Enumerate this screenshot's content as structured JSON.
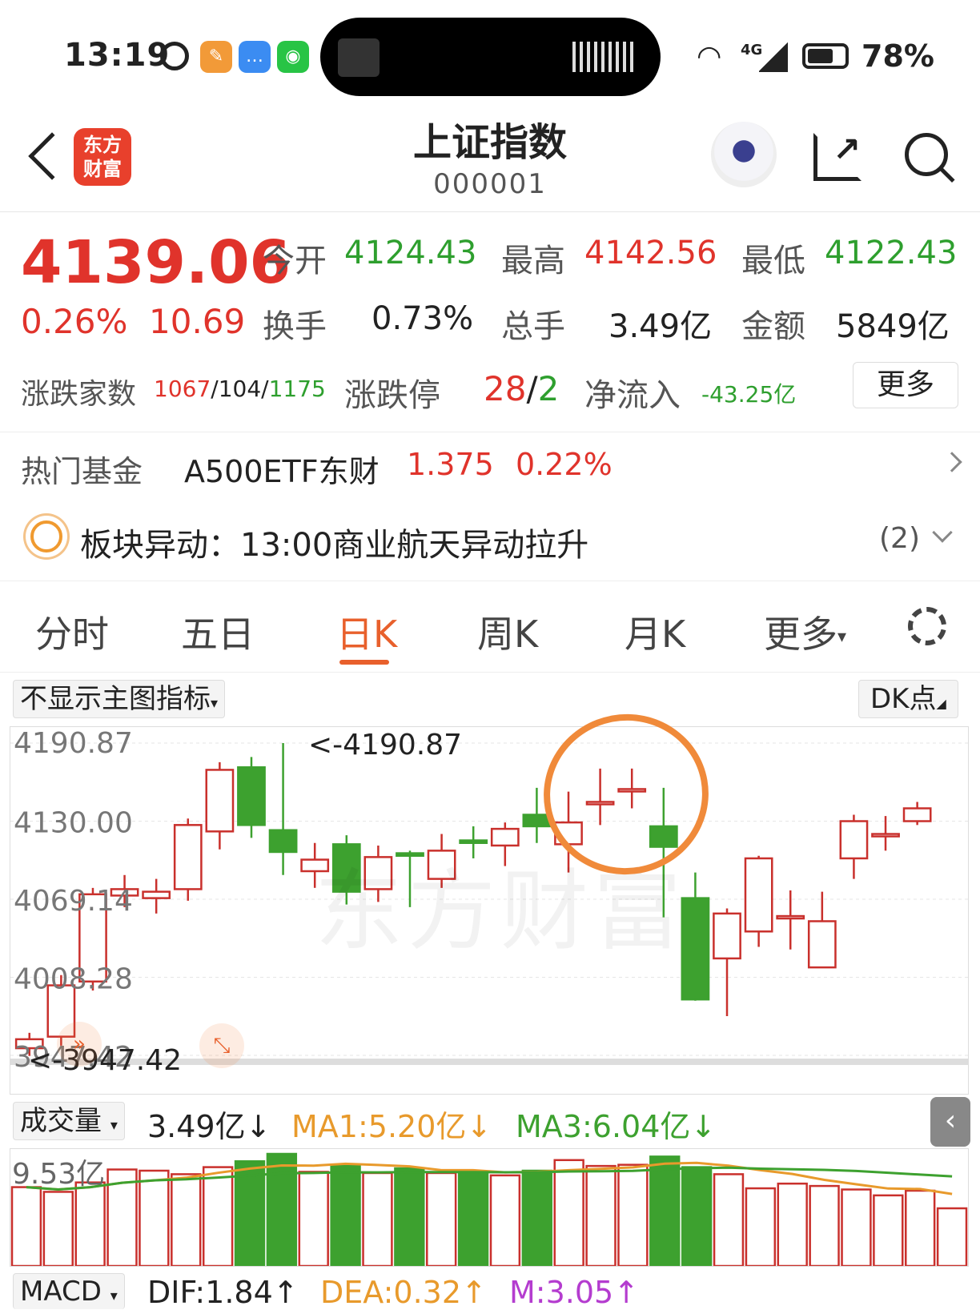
{
  "status_bar": {
    "time": "13:19",
    "signal_tag": "4G",
    "battery": "78%"
  },
  "header": {
    "title": "上证指数",
    "code": "000001",
    "logo_text_1": "东方",
    "logo_text_2": "财富"
  },
  "quote": {
    "price": "4139.06",
    "change_pct": "0.26%",
    "change": "10.69",
    "open_label": "今开",
    "open": "4124.43",
    "high_label": "最高",
    "high": "4142.56",
    "low_label": "最低",
    "low": "4122.43",
    "turnover_label": "换手",
    "turnover": "0.73%",
    "volume_label": "总手",
    "volume": "3.49亿",
    "amount_label": "金额",
    "amount": "5849亿",
    "breadth_label": "涨跌家数",
    "up": "1067",
    "flat": "104",
    "down": "1175",
    "limit_label": "涨跌停",
    "limit_up": "28",
    "limit_down": "2",
    "inflow_label": "净流入",
    "inflow": "-43.25亿",
    "more": "更多"
  },
  "fund": {
    "label": "热门基金",
    "name": "A500ETF东财",
    "price": "1.375",
    "pct": "0.22%"
  },
  "alert": {
    "text": "板块异动：13:00商业航天异动拉升",
    "count": "(2)"
  },
  "tabs": [
    "分时",
    "五日",
    "日K",
    "周K",
    "月K",
    "更多"
  ],
  "active_tab": "日K",
  "chart_controls": {
    "indicator": "不显示主图指标",
    "dk": "DK点",
    "watermark": "东方财富"
  },
  "kline": {
    "y_ticks": [
      "4190.87",
      "4130.00",
      "4069.14",
      "4008.28",
      "3947.42"
    ],
    "max_label": "<-4190.87",
    "min_label": "<-3947.42",
    "colors": {
      "up": "#c9302c",
      "down": "#3da12f"
    }
  },
  "volume_panel": {
    "label": "成交量",
    "value": "3.49亿↓",
    "ma1": "MA1:5.20亿↓",
    "ma3": "MA3:6.04亿↓",
    "max": "9.53亿"
  },
  "macd_panel": {
    "label": "MACD",
    "dif": "DIF:1.84↑",
    "dea": "DEA:0.32↑",
    "m": "M:3.05↑"
  },
  "chart_data": {
    "type": "candlestick",
    "ylim": [
      3947.42,
      4190.87
    ],
    "candles": [
      {
        "o": 3953,
        "c": 3960,
        "h": 3965,
        "l": 3947
      },
      {
        "o": 3962,
        "c": 4002,
        "h": 4010,
        "l": 3955
      },
      {
        "o": 4005,
        "c": 4073,
        "h": 4078,
        "l": 3998
      },
      {
        "o": 4072,
        "c": 4077,
        "h": 4088,
        "l": 4063
      },
      {
        "o": 4070,
        "c": 4075,
        "h": 4085,
        "l": 4058
      },
      {
        "o": 4077,
        "c": 4127,
        "h": 4132,
        "l": 4068
      },
      {
        "o": 4122,
        "c": 4170,
        "h": 4176,
        "l": 4108
      },
      {
        "o": 4172,
        "c": 4127,
        "h": 4180,
        "l": 4117
      },
      {
        "o": 4123,
        "c": 4106,
        "h": 4190.87,
        "l": 4088
      },
      {
        "o": 4091,
        "c": 4100,
        "h": 4113,
        "l": 4078
      },
      {
        "o": 4112,
        "c": 4075,
        "h": 4119,
        "l": 4065
      },
      {
        "o": 4077,
        "c": 4102,
        "h": 4111,
        "l": 4067
      },
      {
        "o": 4105,
        "c": 4103,
        "h": 4107,
        "l": 4063
      },
      {
        "o": 4085,
        "c": 4107,
        "h": 4120,
        "l": 4078
      },
      {
        "o": 4115,
        "c": 4113,
        "h": 4126,
        "l": 4101
      },
      {
        "o": 4111,
        "c": 4124,
        "h": 4129,
        "l": 4095
      },
      {
        "o": 4135,
        "c": 4126,
        "h": 4156,
        "l": 4113
      },
      {
        "o": 4112,
        "c": 4129,
        "h": 4153,
        "l": 4090
      },
      {
        "o": 4144,
        "c": 4145,
        "h": 4171,
        "l": 4127
      },
      {
        "o": 4154,
        "c": 4155,
        "h": 4171,
        "l": 4140
      },
      {
        "o": 4126,
        "c": 4110,
        "h": 4156,
        "l": 4055
      },
      {
        "o": 4070,
        "c": 3991,
        "h": 4090,
        "l": 3990
      },
      {
        "o": 4023,
        "c": 4058,
        "h": 4062,
        "l": 3978
      },
      {
        "o": 4044,
        "c": 4101,
        "h": 4103,
        "l": 4032
      },
      {
        "o": 4055,
        "c": 4056,
        "h": 4076,
        "l": 4030
      },
      {
        "o": 4016,
        "c": 4052,
        "h": 4075,
        "l": 4020
      },
      {
        "o": 4101,
        "c": 4130,
        "h": 4135,
        "l": 4085
      },
      {
        "o": 4119,
        "c": 4120,
        "h": 4134,
        "l": 4107
      },
      {
        "o": 4130,
        "c": 4140,
        "h": 4145,
        "l": 4127
      }
    ],
    "volume": [
      6.7,
      6.3,
      7.1,
      8.2,
      8.1,
      7.8,
      8.4,
      8.9,
      9.53,
      8.0,
      8.6,
      7.9,
      8.3,
      7.9,
      8.0,
      7.7,
      8.1,
      9.0,
      8.5,
      8.6,
      9.3,
      8.4,
      7.8,
      6.6,
      7.0,
      6.8,
      6.5,
      6.0,
      6.4,
      4.9
    ]
  }
}
